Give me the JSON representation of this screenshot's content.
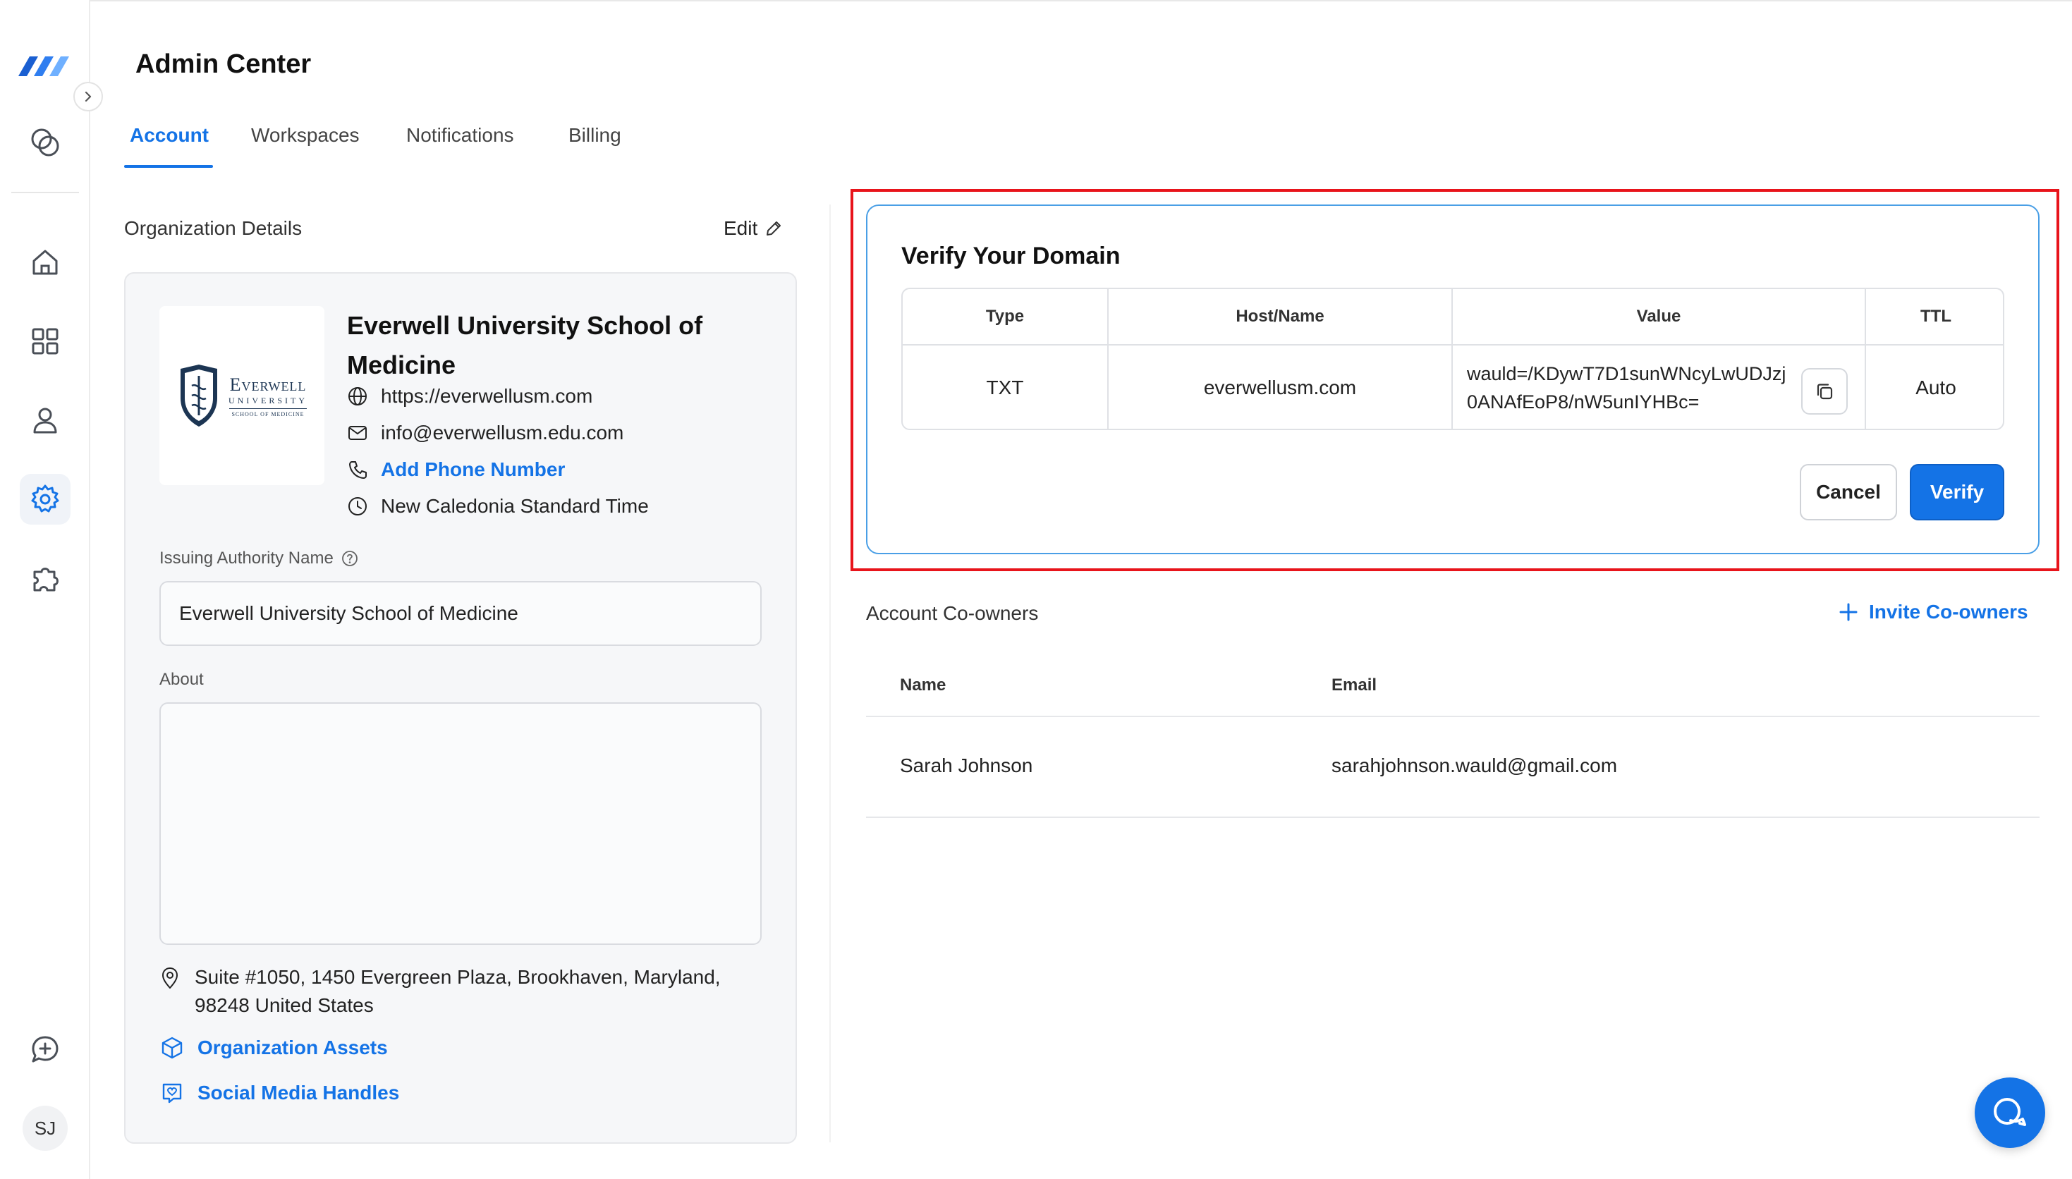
{
  "app": {
    "title": "Admin Center",
    "brand_color": "#1473e6"
  },
  "tabs": [
    {
      "label": "Account",
      "active": true
    },
    {
      "label": "Workspaces",
      "active": false
    },
    {
      "label": "Notifications",
      "active": false
    },
    {
      "label": "Billing",
      "active": false
    }
  ],
  "sidebar": {
    "items": [
      {
        "icon": "circles-icon"
      },
      {
        "icon": "home-icon"
      },
      {
        "icon": "grid-icon"
      },
      {
        "icon": "user-icon"
      },
      {
        "icon": "gear-icon",
        "active": true
      },
      {
        "icon": "puzzle-icon"
      }
    ],
    "bottom": {
      "icon": "chat-plus-icon",
      "avatar_initials": "SJ"
    }
  },
  "org": {
    "section_label": "Organization Details",
    "edit_label": "Edit",
    "logo": {
      "name": "Everwell",
      "subtitle": "University",
      "tagline": "School of Medicine"
    },
    "name": "Everwell University School of Medicine",
    "website": "https://everwellusm.com",
    "email": "info@everwellusm.edu.com",
    "phone_link": "Add Phone Number",
    "timezone": "New Caledonia Standard Time",
    "issuing_label": "Issuing Authority Name",
    "issuing_value": "Everwell University School of Medicine",
    "about_label": "About",
    "about_value": "",
    "address": "Suite #1050, 1450 Evergreen Plaza, Brookhaven, Maryland, 98248 United States",
    "assets_link": "Organization Assets",
    "social_link": "Social Media Handles"
  },
  "verify": {
    "title": "Verify Your Domain",
    "headers": {
      "type": "Type",
      "host": "Host/Name",
      "value": "Value",
      "ttl": "TTL"
    },
    "row": {
      "type": "TXT",
      "host": "everwellusm.com",
      "value": "wauld=/KDywT7D1sunWNcyLwUDJzj0ANAfEoP8/nW5unIYHBc=",
      "ttl": "Auto"
    },
    "cancel_label": "Cancel",
    "verify_label": "Verify"
  },
  "coowners": {
    "section_label": "Account Co-owners",
    "invite_label": "Invite Co-owners",
    "headers": {
      "name": "Name",
      "email": "Email"
    },
    "rows": [
      {
        "name": "Sarah Johnson",
        "email": "sarahjohnson.wauld@gmail.com"
      }
    ]
  }
}
